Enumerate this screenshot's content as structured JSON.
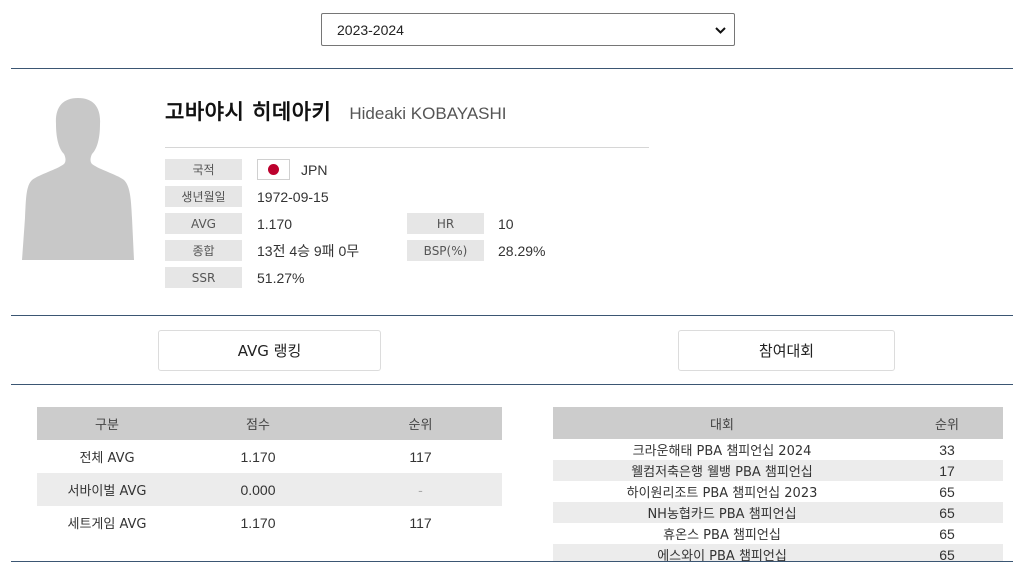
{
  "season": {
    "selected": "2023-2024"
  },
  "player": {
    "name_ko": "고바야시 히데아키",
    "name_en": "Hideaki KOBAYASHI"
  },
  "info": {
    "nationality_label": "국적",
    "nationality_value": "JPN",
    "birth_label": "생년월일",
    "birth_value": "1972-09-15",
    "avg_label": "AVG",
    "avg_value": "1.170",
    "hr_label": "HR",
    "hr_value": "10",
    "record_label": "종합",
    "record_value": "13전 4승 9패 0무",
    "bsp_label": "BSP(%)",
    "bsp_value": "28.29%",
    "ssr_label": "SSR",
    "ssr_value": "51.27%"
  },
  "tabs": {
    "avg_ranking": "AVG 랭킹",
    "tournaments": "참여대회"
  },
  "avg_table": {
    "headers": [
      "구분",
      "점수",
      "순위"
    ],
    "rows": [
      [
        "전체 AVG",
        "1.170",
        "117"
      ],
      [
        "서바이벌 AVG",
        "0.000",
        "-"
      ],
      [
        "세트게임 AVG",
        "1.170",
        "117"
      ]
    ]
  },
  "tournament_table": {
    "headers": [
      "대회",
      "순위"
    ],
    "rows": [
      [
        "크라운해태 PBA 챔피언십 2024",
        "33"
      ],
      [
        "웰컴저축은행 웰뱅 PBA 챔피언십",
        "17"
      ],
      [
        "하이원리조트 PBA 챔피언십 2023",
        "65"
      ],
      [
        "NH농협카드 PBA 챔피언십",
        "65"
      ],
      [
        "휴온스 PBA 챔피언십",
        "65"
      ],
      [
        "에스와이 PBA 챔피언십",
        "65"
      ]
    ]
  },
  "icons": {
    "dropdown": "chevron-down-icon",
    "avatar": "person-silhouette-icon",
    "flag": "japan-flag-icon"
  },
  "colors": {
    "divider": "#3b5673",
    "label_bg": "#e6e6e6",
    "header_bg": "#cccccc",
    "flag_red": "#bc002d"
  }
}
